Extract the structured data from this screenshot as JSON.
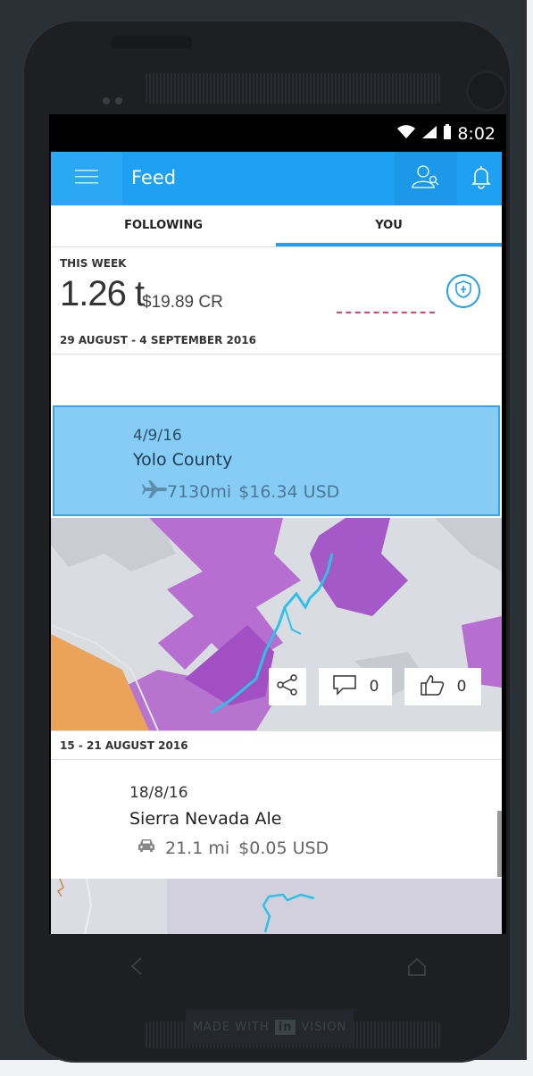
{
  "status_bar": {
    "time": "8:02"
  },
  "app_bar": {
    "title": "Feed"
  },
  "tabs": [
    {
      "label": "FOLLOWING",
      "selected": false
    },
    {
      "label": "YOU",
      "selected": true
    }
  ],
  "this_week": {
    "label": "THIS WEEK",
    "tons": "1.26 t",
    "credit": "$19.89 CR",
    "date_range": "29 AUGUST - 4 SEPTEMBER 2016"
  },
  "trips": [
    {
      "date": "4/9/16",
      "name": "Yolo County",
      "mode_icon": "airplane-icon",
      "distance": "7130mi",
      "cost": "$16.34 USD",
      "shares": "",
      "comments": "0",
      "likes": "0"
    },
    {
      "date": "18/8/16",
      "name": "Sierra Nevada Ale",
      "mode_icon": "car-icon",
      "distance": "21.1 mi",
      "cost": "$0.05 USD"
    }
  ],
  "second_range": "15 - 21 AUGUST 2016",
  "footer": {
    "made_with": "MADE WITH",
    "brand_in": "in",
    "brand_vision": "VISION"
  },
  "colors": {
    "accent": "#1ea1f2",
    "selected_card": "#86cdf6",
    "map_purple": "#b36ed1",
    "route": "#2fc0e8",
    "dash": "#e83e6c"
  }
}
